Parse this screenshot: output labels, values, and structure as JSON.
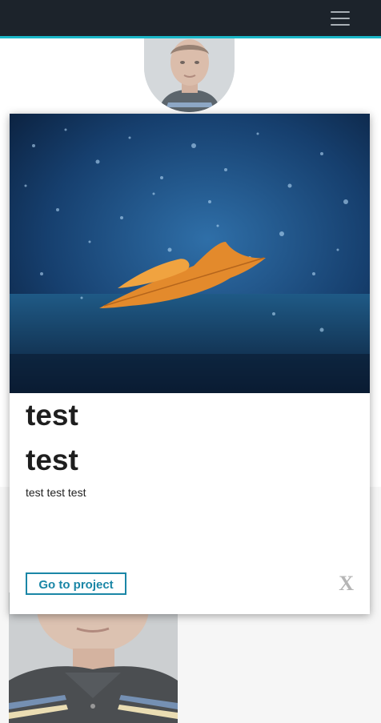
{
  "navbar": {
    "menu_icon": "hamburger-menu-icon",
    "accent_color": "#1bb7c8",
    "background_color": "#1c232b"
  },
  "modal": {
    "image_icon": "leaf-on-water-photo",
    "title_1": "test",
    "title_2": "test",
    "description": "test test test",
    "go_button_label": "Go to project",
    "close_label": "X"
  },
  "colors": {
    "button_accent": "#1a86a6"
  }
}
